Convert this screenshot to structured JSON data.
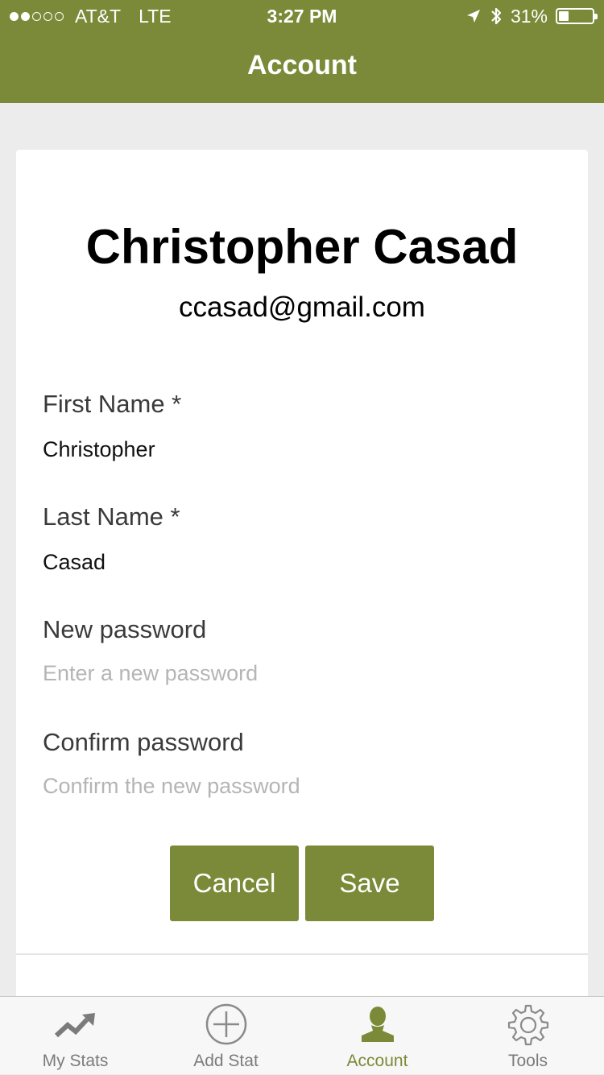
{
  "status_bar": {
    "carrier": "AT&T",
    "network": "LTE",
    "time": "3:27 PM",
    "battery": "31%",
    "battery_level": 0.31
  },
  "nav": {
    "title": "Account"
  },
  "profile": {
    "name": "Christopher Casad",
    "email": "ccasad@gmail.com"
  },
  "form": {
    "first_name": {
      "label": "First Name *",
      "value": "Christopher"
    },
    "last_name": {
      "label": "Last Name *",
      "value": "Casad"
    },
    "new_password": {
      "label": "New password",
      "placeholder": "Enter a new password"
    },
    "confirm_password": {
      "label": "Confirm password",
      "placeholder": "Confirm the new password"
    },
    "cancel_label": "Cancel",
    "save_label": "Save"
  },
  "tabbar": {
    "items": [
      {
        "label": "My Stats",
        "icon": "trending-up-icon",
        "active": false
      },
      {
        "label": "Add Stat",
        "icon": "add-circle-icon",
        "active": false
      },
      {
        "label": "Account",
        "icon": "person-icon",
        "active": true
      },
      {
        "label": "Tools",
        "icon": "gear-icon",
        "active": false
      }
    ]
  },
  "colors": {
    "brand": "#7b8a38",
    "background": "#ececec",
    "tab_inactive": "#7b7b7b"
  }
}
